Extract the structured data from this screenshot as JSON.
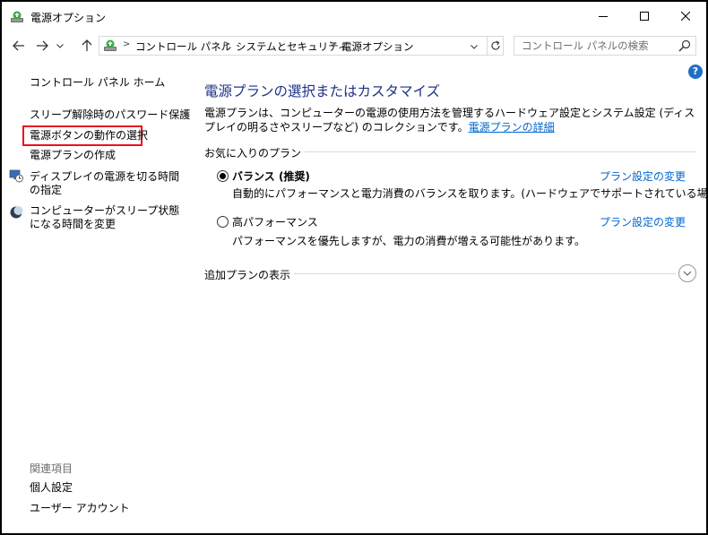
{
  "window": {
    "title": "電源オプション",
    "minimize_icon": "minimize-icon",
    "maximize_icon": "maximize-icon",
    "close_icon": "close-icon"
  },
  "address_bar": {
    "breadcrumbs": [
      "コントロール パネル",
      "システムとセキュリティ",
      "電源オプション"
    ],
    "search_placeholder": "コントロール パネルの検索"
  },
  "sidebar": {
    "home": "コントロール パネル ホーム",
    "links": [
      "スリープ解除時のパスワード保護",
      "電源ボタンの動作の選択",
      "電源プランの作成",
      "ディスプレイの電源を切る時間の指定",
      "コンピューターがスリープ状態になる時間を変更"
    ],
    "related_heading": "関連項目",
    "related": [
      "個人設定",
      "ユーザー アカウント"
    ]
  },
  "main": {
    "title": "電源プランの選択またはカスタマイズ",
    "description": "電源プランは、コンピューターの電源の使用方法を管理するハードウェア設定とシステム設定 (ディスプレイの明るさやスリープなど) のコレクションです。",
    "description_link": "電源プランの詳細",
    "favorites_label": "お気に入りのプラン",
    "plans": [
      {
        "name": "バランス (推奨)",
        "selected": true,
        "description": "自動的にパフォーマンスと電力消費のバランスを取ります。(ハードウェアでサポートされている場合)",
        "change_link": "プラン設定の変更"
      },
      {
        "name": "高パフォーマンス",
        "selected": false,
        "description": "パフォーマンスを優先しますが、電力の消費が増える可能性があります。",
        "change_link": "プラン設定の変更"
      }
    ],
    "additional_label": "追加プランの表示"
  },
  "colors": {
    "title_blue": "#1e3287",
    "link_blue": "#0066cc",
    "highlight_red": "#e81123"
  }
}
